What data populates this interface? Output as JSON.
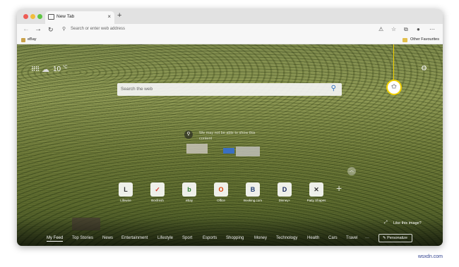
{
  "browser": {
    "tab": {
      "title": "New Tab",
      "close_glyph": "×"
    },
    "new_tab_glyph": "+",
    "address": {
      "placeholder": "Search or enter web address"
    },
    "favorites": {
      "left": "eBay",
      "right": "Other Favourites"
    }
  },
  "newtab": {
    "weather": {
      "temp": "10",
      "unit": "°C"
    },
    "search_placeholder": "Search the web",
    "image_caption": "We may not be able to show this content",
    "quick_links": [
      {
        "label": "Lifewire",
        "glyph": "L",
        "color": "#333333"
      },
      {
        "label": "Boxfresh",
        "glyph": "✓",
        "color": "#d63a2a"
      },
      {
        "label": "eBay",
        "glyph": "b",
        "color": "#2f7d32"
      },
      {
        "label": "Office",
        "glyph": "O",
        "color": "#d83b01"
      },
      {
        "label": "Booking.com",
        "glyph": "B",
        "color": "#1e3a70"
      },
      {
        "label": "Disney+",
        "glyph": "D",
        "color": "#13225a"
      },
      {
        "label": "Patty Shapes",
        "glyph": "✕",
        "color": "#333333"
      }
    ],
    "like_text": "Like this image?",
    "feed_tabs": [
      "My Feed",
      "Top Stories",
      "News",
      "Entertainment",
      "Lifestyle",
      "Sport",
      "Esports",
      "Shopping",
      "Money",
      "Technology",
      "Health",
      "Cars",
      "Travel",
      "···"
    ],
    "personalize_label": "Personalize"
  },
  "watermark": "wsxdn.com"
}
